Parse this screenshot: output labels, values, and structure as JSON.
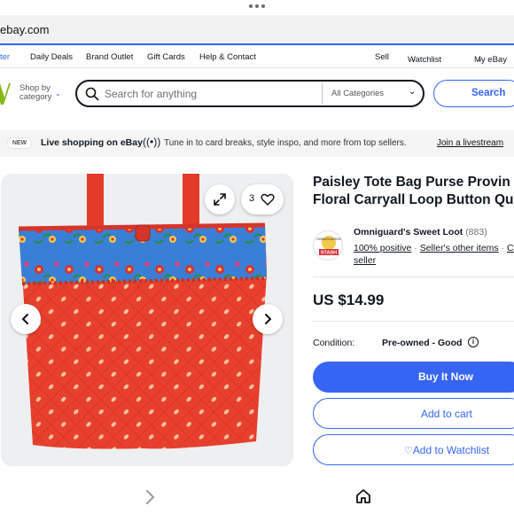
{
  "browser": {
    "url": "ebay.com"
  },
  "topnav": {
    "partial_first": "ter",
    "daily_deals": "Daily Deals",
    "brand_outlet": "Brand Outlet",
    "gift_cards": "Gift Cards",
    "help_contact": "Help & Contact",
    "sell": "Sell",
    "watchlist": "Watchlist",
    "my_ebay": "My eBay"
  },
  "header": {
    "shop_by_line1": "Shop by",
    "shop_by_line2": "category",
    "search_placeholder": "Search for anything",
    "category_select": "All Categories",
    "search_button": "Search"
  },
  "banner": {
    "badge": "NEW",
    "live": "Live shopping on eBay",
    "description": "Tune in to card breaks, style inspo, and more from top sellers.",
    "join_link": "Join a livestream"
  },
  "gallery": {
    "watch_count": "3"
  },
  "product": {
    "title_line1": "Paisley Tote Bag Purse Provin",
    "title_line2": "Floral Carryall Loop Button Qu",
    "price": "US $14.99",
    "condition_label": "Condition:",
    "condition_value": "Pre-owned - Good"
  },
  "seller": {
    "logo_text_top": "OMNIGUARDS",
    "logo_text_bottom": "STASH",
    "name": "Omniguard's Sweet Loot",
    "feedback": "(883)",
    "positive": "100% positive",
    "other_items": "Seller's other items",
    "contact_frag": "Co",
    "contact_line2": "seller"
  },
  "actions": {
    "buy_now": "Buy It Now",
    "add_to_cart": "Add to cart",
    "watchlist": "Add to Watchlist"
  },
  "colors": {
    "accent": "#3665f3",
    "bag_red": "#e8402f",
    "band_blue": "#3a7fd6"
  }
}
